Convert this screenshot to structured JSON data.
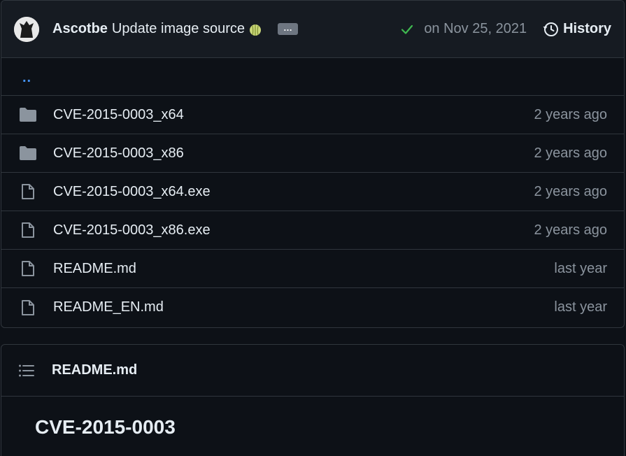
{
  "commit": {
    "author": "Ascotbe",
    "message": "Update image source",
    "ellipsis": "…",
    "date": "on Nov 25, 2021",
    "history_label": "History"
  },
  "parent_link": "..",
  "files": [
    {
      "type": "folder",
      "name": "CVE-2015-0003_x64",
      "age": "2 years ago"
    },
    {
      "type": "folder",
      "name": "CVE-2015-0003_x86",
      "age": "2 years ago"
    },
    {
      "type": "file",
      "name": "CVE-2015-0003_x64.exe",
      "age": "2 years ago"
    },
    {
      "type": "file",
      "name": "CVE-2015-0003_x86.exe",
      "age": "2 years ago"
    },
    {
      "type": "file",
      "name": "README.md",
      "age": "last year"
    },
    {
      "type": "file",
      "name": "README_EN.md",
      "age": "last year"
    }
  ],
  "readme": {
    "title": "README.md",
    "heading": "CVE-2015-0003"
  },
  "colors": {
    "background": "#0d1117",
    "header_bg": "#161b22",
    "border": "#30363d",
    "link": "#4493f8",
    "muted": "#8b949e",
    "success": "#3fb950",
    "icon": "#8b949e"
  }
}
